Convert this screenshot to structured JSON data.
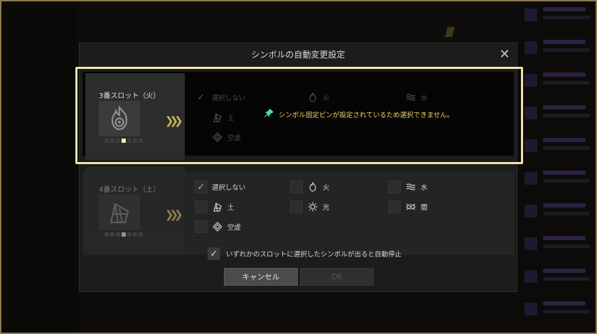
{
  "dialog": {
    "title": "シンボルの自動変更設定",
    "close_label": "✕"
  },
  "slots": [
    {
      "name": "3番スロット（火）",
      "emblem_icon": "flame-icon",
      "notice": "シンボル固定ピンが設定されているため選択できません。",
      "options": {
        "none": "選択しない",
        "fire": "火",
        "water": "水",
        "earth": "土",
        "void": "空虚"
      }
    },
    {
      "name": "4番スロット（土）",
      "emblem_icon": "earth-rune-icon",
      "options": {
        "none": "選択しない",
        "fire": "火",
        "water": "水",
        "earth": "土",
        "light": "光",
        "dark": "闇",
        "void": "空虚"
      }
    }
  ],
  "auto_stop_label": "いずれかのスロットに選択したシンボルが出ると自動停止",
  "buttons": {
    "cancel": "キャンセル",
    "ok": "OK"
  },
  "colors": {
    "accent_gold": "#c8b35a",
    "notice_yellow": "#f0d468",
    "highlight_border": "#f3e2b0",
    "pin_green": "#4de0b0"
  }
}
